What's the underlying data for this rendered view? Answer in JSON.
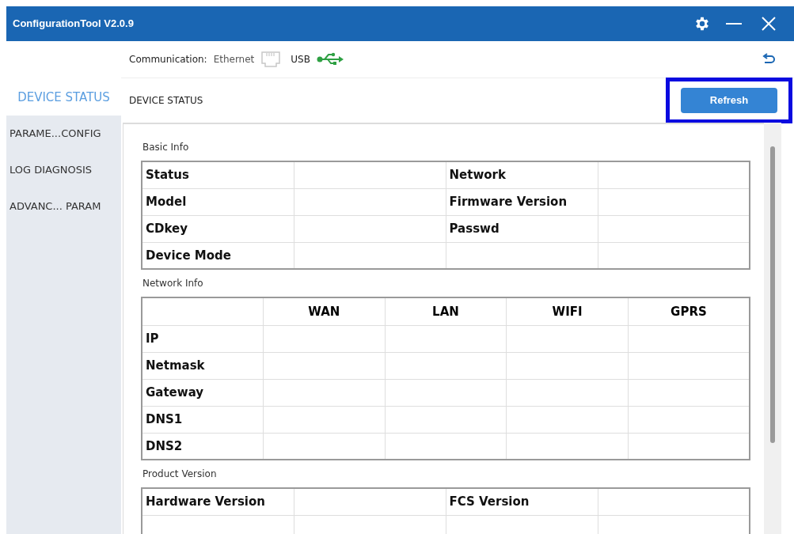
{
  "window": {
    "title": "ConfigurationTool V2.0.9"
  },
  "sidebar": {
    "items": [
      {
        "label": "DEVICE STATUS",
        "selected": true
      },
      {
        "label": "PARAME...CONFIG",
        "selected": false
      },
      {
        "label": "LOG DIAGNOSIS",
        "selected": false
      },
      {
        "label": "ADVANC... PARAM",
        "selected": false
      }
    ]
  },
  "communication": {
    "label": "Communication:",
    "options": [
      {
        "label": "Ethernet",
        "kind": "ethernet",
        "active": false
      },
      {
        "label": "USB",
        "kind": "usb",
        "active": true
      }
    ]
  },
  "page_title": "DEVICE STATUS",
  "refresh_button": "Refresh",
  "sections": [
    {
      "title": "Basic Info",
      "rows": [
        [
          "Status",
          "",
          "Network",
          ""
        ],
        [
          "Model",
          "",
          "Firmware Version",
          ""
        ],
        [
          "CDkey",
          "",
          "Passwd",
          ""
        ],
        [
          "Device Mode",
          "",
          "",
          ""
        ]
      ]
    },
    {
      "title": "Network Info",
      "columns": [
        "",
        "WAN",
        "LAN",
        "WIFI",
        "GPRS"
      ],
      "rows": [
        [
          "IP",
          "",
          "",
          "",
          ""
        ],
        [
          "Netmask",
          "",
          "",
          "",
          ""
        ],
        [
          "Gateway",
          "",
          "",
          "",
          ""
        ],
        [
          "DNS1",
          "",
          "",
          "",
          ""
        ],
        [
          "DNS2",
          "",
          "",
          "",
          ""
        ]
      ]
    },
    {
      "title": "Product Version",
      "rows": [
        [
          "Hardware Version",
          "",
          "FCS Version",
          ""
        ],
        [
          "",
          "",
          "",
          ""
        ]
      ]
    }
  ]
}
